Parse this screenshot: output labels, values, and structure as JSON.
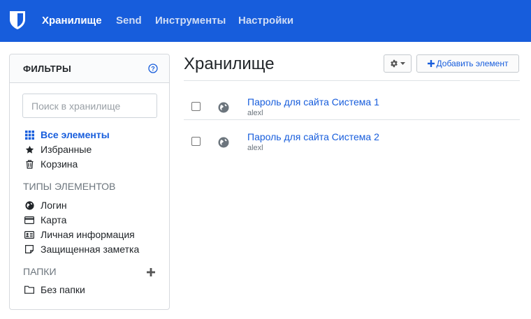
{
  "nav": {
    "items": [
      {
        "label": "Хранилище",
        "active": true
      },
      {
        "label": "Send",
        "active": false
      },
      {
        "label": "Инструменты",
        "active": false
      },
      {
        "label": "Настройки",
        "active": false
      }
    ]
  },
  "filters": {
    "title": "ФИЛЬТРЫ",
    "search_placeholder": "Поиск в хранилище",
    "main": [
      {
        "label": "Все элементы",
        "icon": "grid-icon",
        "active": true
      },
      {
        "label": "Избранные",
        "icon": "star-icon",
        "active": false
      },
      {
        "label": "Корзина",
        "icon": "trash-icon",
        "active": false
      }
    ],
    "types_title": "ТИПЫ ЭЛЕМЕНТОВ",
    "types": [
      {
        "label": "Логин",
        "icon": "globe-icon"
      },
      {
        "label": "Карта",
        "icon": "credit-card-icon"
      },
      {
        "label": "Личная информация",
        "icon": "id-card-icon"
      },
      {
        "label": "Защищенная заметка",
        "icon": "note-icon"
      }
    ],
    "folders_title": "ПАПКИ",
    "folders": [
      {
        "label": "Без папки",
        "icon": "folder-icon"
      }
    ]
  },
  "main": {
    "title": "Хранилище",
    "add_label": "Добавить элемент",
    "items": [
      {
        "name": "Пароль для сайта Система 1",
        "username": "alexl"
      },
      {
        "name": "Пароль для сайта Система 2",
        "username": "alexl"
      }
    ]
  },
  "colors": {
    "brand": "#175ddc",
    "nav_text_inactive": "#cfdcf5"
  }
}
